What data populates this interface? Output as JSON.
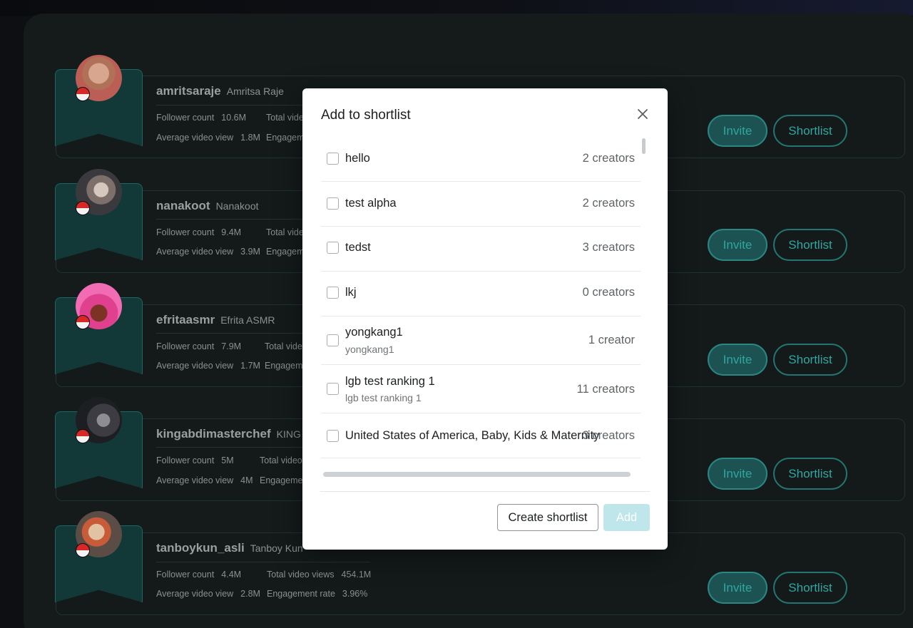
{
  "creators": [
    {
      "handle": "amritsaraje",
      "name": "Amritsa Raje",
      "follower_label": "Follower count",
      "follower": "10.6M",
      "avg_label": "Average video view",
      "avg": "1.8M",
      "total_label": "Total vide",
      "eng_label": "Engageme"
    },
    {
      "handle": "nanakoot",
      "name": "Nanakoot",
      "follower_label": "Follower count",
      "follower": "9.4M",
      "avg_label": "Average video view",
      "avg": "3.9M",
      "total_label": "Total vide",
      "eng_label": "Engagem"
    },
    {
      "handle": "efritaasmr",
      "name": "Efrita ASMR",
      "follower_label": "Follower count",
      "follower": "7.9M",
      "avg_label": "Average video view",
      "avg": "1.7M",
      "total_label": "Total vide",
      "eng_label": "Engageme"
    },
    {
      "handle": "kingabdimasterchef",
      "name": "KING A",
      "follower_label": "Follower count",
      "follower": "5M",
      "avg_label": "Average video view",
      "avg": "4M",
      "total_label": "Total video",
      "eng_label": "Engageme"
    },
    {
      "handle": "tanboykun_asli",
      "name": "Tanboy Kun",
      "follower_label": "Follower count",
      "follower": "4.4M",
      "avg_label": "Average video view",
      "avg": "2.8M",
      "total_label": "Total video views",
      "total": "454.1M",
      "eng_label": "Engagement rate",
      "eng": "3.96%"
    }
  ],
  "buttons": {
    "invite": "Invite",
    "shortlist": "Shortlist"
  },
  "modal": {
    "title": "Add to shortlist",
    "items": [
      {
        "title": "hello",
        "sub": "",
        "count": "2 creators"
      },
      {
        "title": "test alpha",
        "sub": "",
        "count": "2 creators"
      },
      {
        "title": "tedst",
        "sub": "",
        "count": "3 creators"
      },
      {
        "title": "lkj",
        "sub": "",
        "count": "0 creators"
      },
      {
        "title": "yongkang1",
        "sub": "yongkang1",
        "count": "1 creator"
      },
      {
        "title": "lgb test ranking 1",
        "sub": "lgb test ranking 1",
        "count": "11 creators"
      },
      {
        "title": "United States of America, Baby, Kids & Maternity",
        "sub": "",
        "count": "3 creators"
      }
    ],
    "create_label": "Create shortlist",
    "add_label": "Add"
  }
}
